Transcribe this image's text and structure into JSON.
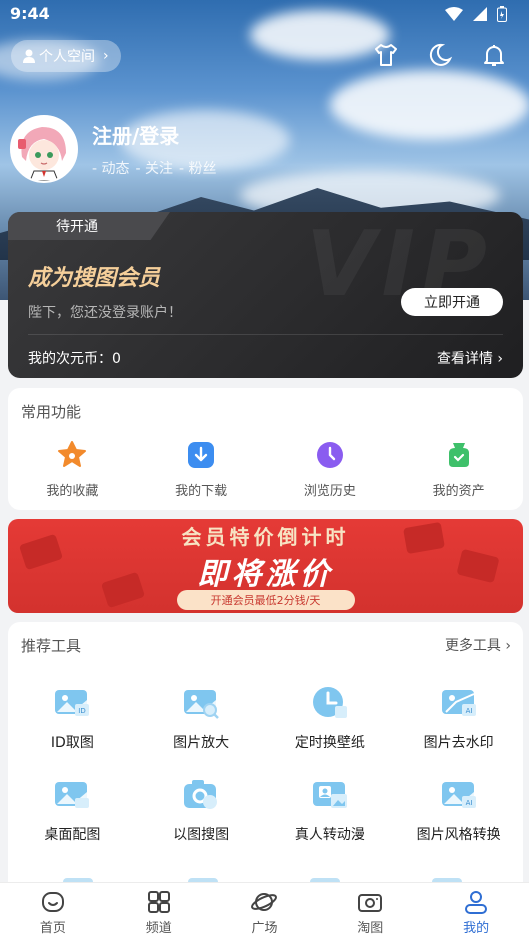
{
  "status_bar": {
    "time": "9:44"
  },
  "header": {
    "space_button": "个人空间",
    "login_title": "注册/登录",
    "stats": [
      "- 动态",
      "- 关注",
      "- 粉丝"
    ]
  },
  "vip": {
    "tab": "待开通",
    "watermark": "VIP",
    "title": "成为搜图会员",
    "desc": "陛下，您还没登录账户！",
    "open_button": "立即开通",
    "coin": "我的次元币：0",
    "detail": "查看详情 ›"
  },
  "common": {
    "title": "常用功能",
    "items": [
      {
        "label": "我的收藏",
        "icon": "star-icon",
        "color": "#f28a2c"
      },
      {
        "label": "我的下载",
        "icon": "download-icon",
        "color": "#3c8df0"
      },
      {
        "label": "浏览历史",
        "icon": "clock-icon",
        "color": "#8a5cf0"
      },
      {
        "label": "我的资产",
        "icon": "wallet-icon",
        "color": "#3ec06a"
      }
    ]
  },
  "banner": {
    "line1": "会员特价倒计时",
    "line2": "即将涨价",
    "line3": "开通会员最低2分钱/天"
  },
  "tools": {
    "title": "推荐工具",
    "more": "更多工具 ›",
    "items": [
      {
        "label": "ID取图",
        "icon": "id-photo-icon"
      },
      {
        "label": "图片放大",
        "icon": "image-zoom-icon"
      },
      {
        "label": "定时换壁纸",
        "icon": "timer-wallpaper-icon"
      },
      {
        "label": "图片去水印",
        "icon": "remove-watermark-icon"
      },
      {
        "label": "桌面配图",
        "icon": "desktop-image-icon"
      },
      {
        "label": "以图搜图",
        "icon": "image-search-icon"
      },
      {
        "label": "真人转动漫",
        "icon": "photo-to-anime-icon"
      },
      {
        "label": "图片风格转换",
        "icon": "style-transfer-icon"
      }
    ]
  },
  "bottom_nav": {
    "items": [
      {
        "label": "首页",
        "icon": "home-icon"
      },
      {
        "label": "频道",
        "icon": "grid-icon"
      },
      {
        "label": "广场",
        "icon": "planet-icon"
      },
      {
        "label": "淘图",
        "icon": "camera-icon"
      },
      {
        "label": "我的",
        "icon": "profile-icon",
        "active": true
      }
    ]
  },
  "colors": {
    "accent": "#2f6ed3",
    "vip_gold": "#f5cf9a",
    "banner_red": "#e53a36"
  }
}
